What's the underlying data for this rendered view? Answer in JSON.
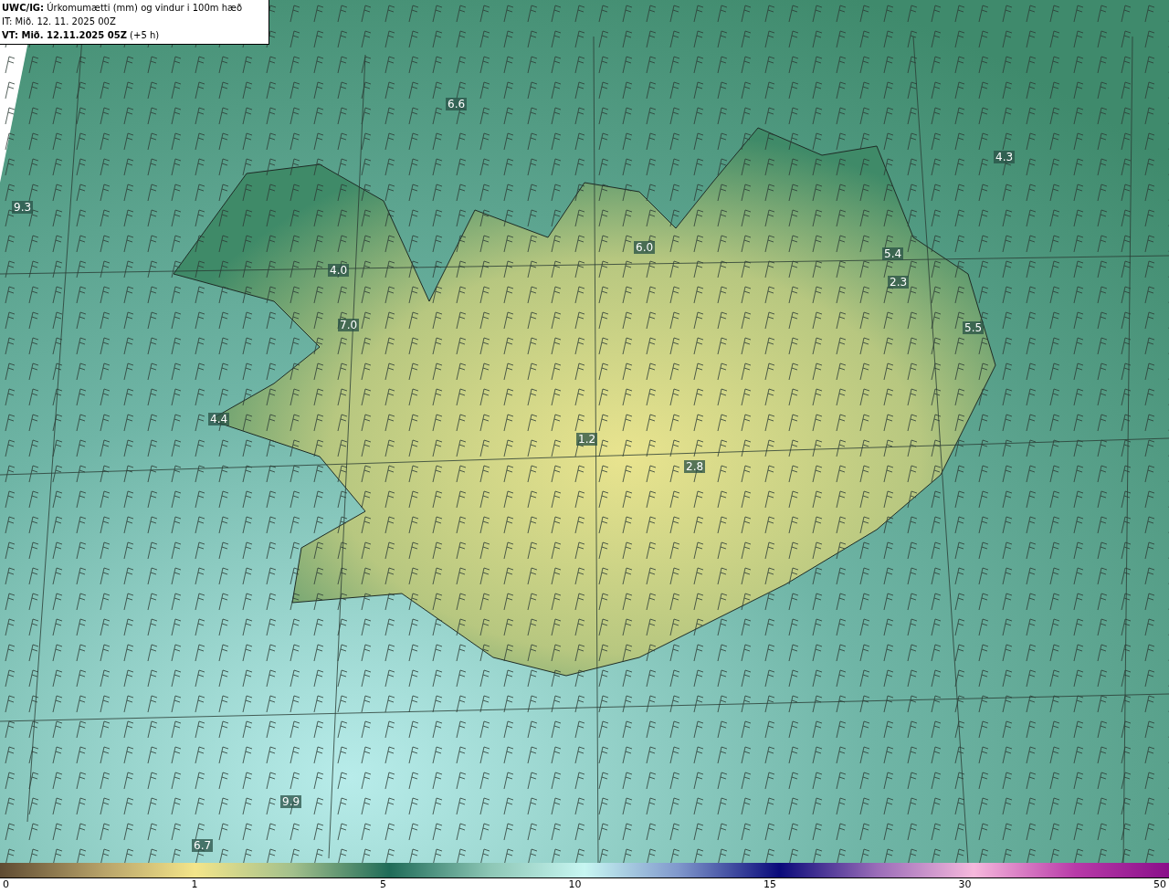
{
  "header": {
    "lines": [
      "**UWC/IG:** Úrkomumætti (mm) og vindur i 100m hæð",
      "IT: Mið. 12. 11. 2025 00Z",
      "**VT: Mið. 12.11.2025 05Z** (+5 h)"
    ]
  },
  "map": {
    "value_labels": [
      "6.6",
      "4.3",
      "9.3",
      "4.0",
      "6.0",
      "5.4",
      "2.3",
      "7.0",
      "5.5",
      "4.4",
      "1.2",
      "2.8",
      "9.9",
      "6.7"
    ]
  },
  "colorbar": {
    "ticks": [
      "0",
      "1",
      "5",
      "10",
      "15",
      "30",
      "50"
    ]
  }
}
